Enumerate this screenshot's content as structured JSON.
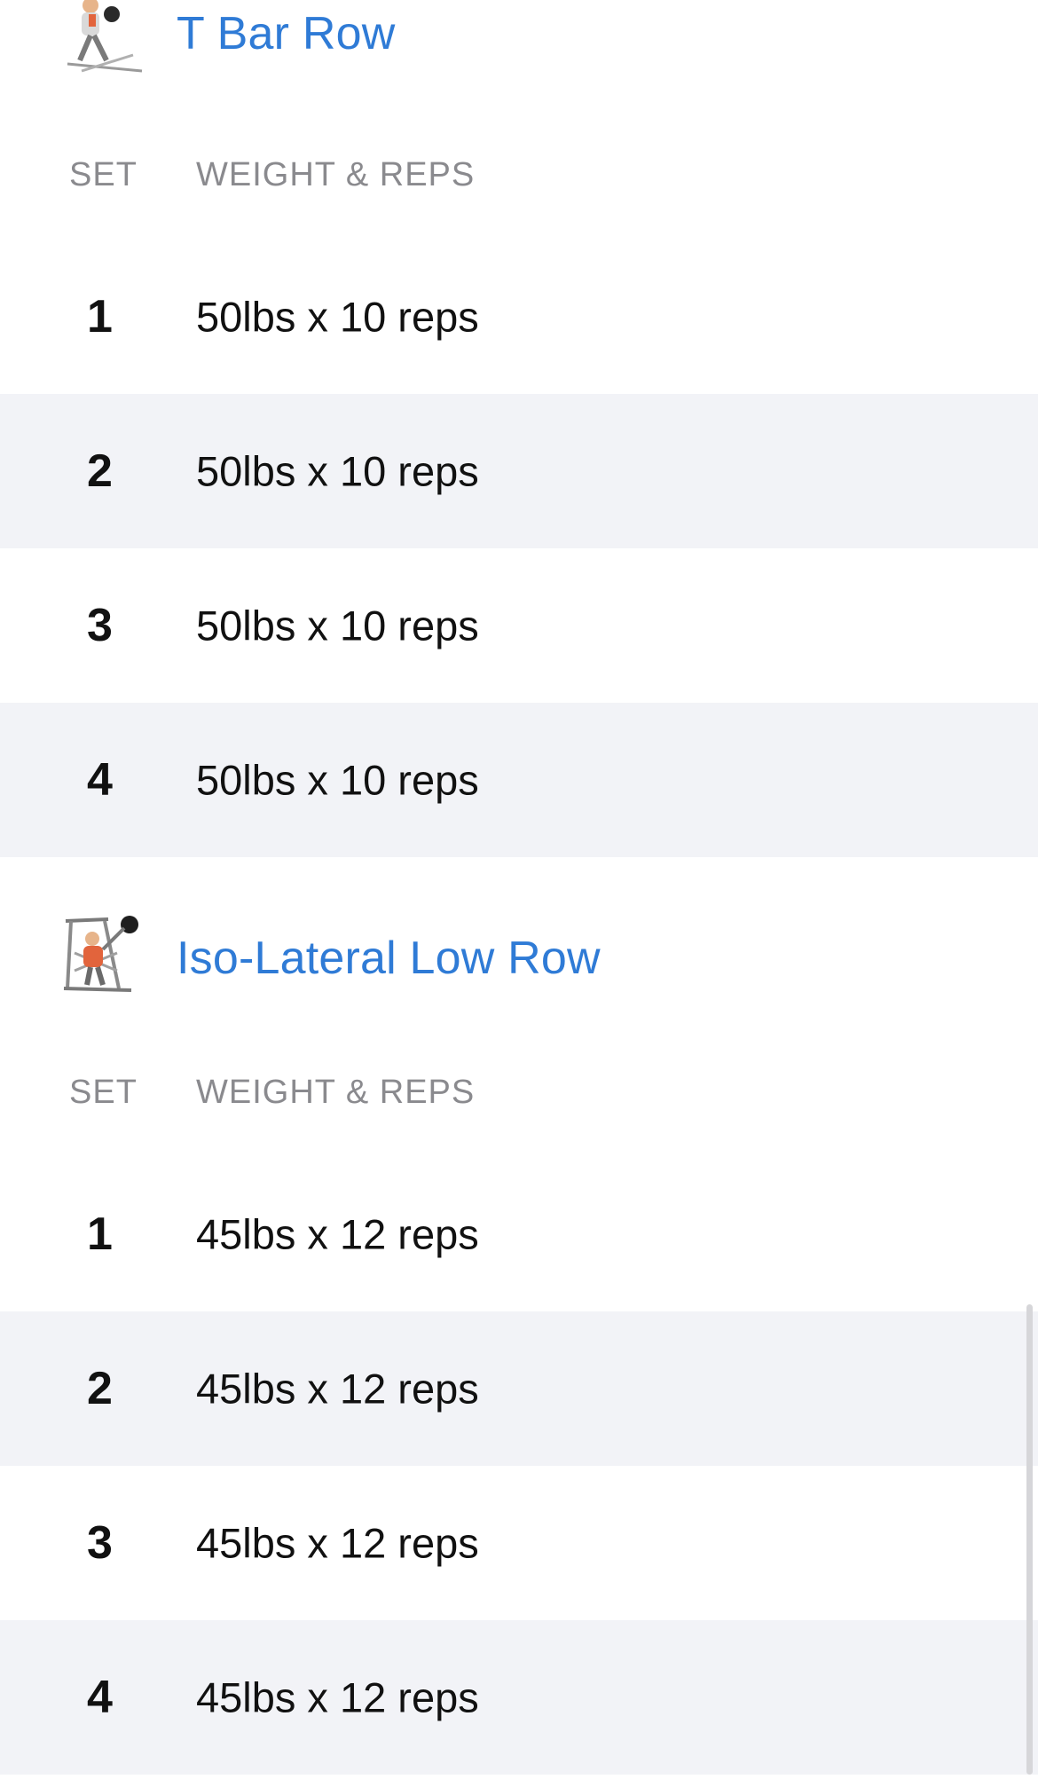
{
  "exercises": [
    {
      "name": "T Bar Row",
      "thumbnail_icon": "t-bar-row-exercise-icon",
      "col_set": "SET",
      "col_weight_reps": "WEIGHT & REPS",
      "sets": [
        {
          "number": "1",
          "value": "50lbs x 10 reps"
        },
        {
          "number": "2",
          "value": "50lbs x 10 reps"
        },
        {
          "number": "3",
          "value": "50lbs x 10 reps"
        },
        {
          "number": "4",
          "value": "50lbs x 10 reps"
        }
      ]
    },
    {
      "name": "Iso-Lateral Low Row",
      "thumbnail_icon": "iso-lateral-low-row-exercise-icon",
      "col_set": "SET",
      "col_weight_reps": "WEIGHT & REPS",
      "sets": [
        {
          "number": "1",
          "value": "45lbs x 12 reps"
        },
        {
          "number": "2",
          "value": "45lbs x 12 reps"
        },
        {
          "number": "3",
          "value": "45lbs x 12 reps"
        },
        {
          "number": "4",
          "value": "45lbs x 12 reps"
        }
      ]
    }
  ],
  "colors": {
    "accent": "#2f7bd6",
    "alt_row": "#f2f3f7",
    "header_text": "#8a8a8e"
  }
}
